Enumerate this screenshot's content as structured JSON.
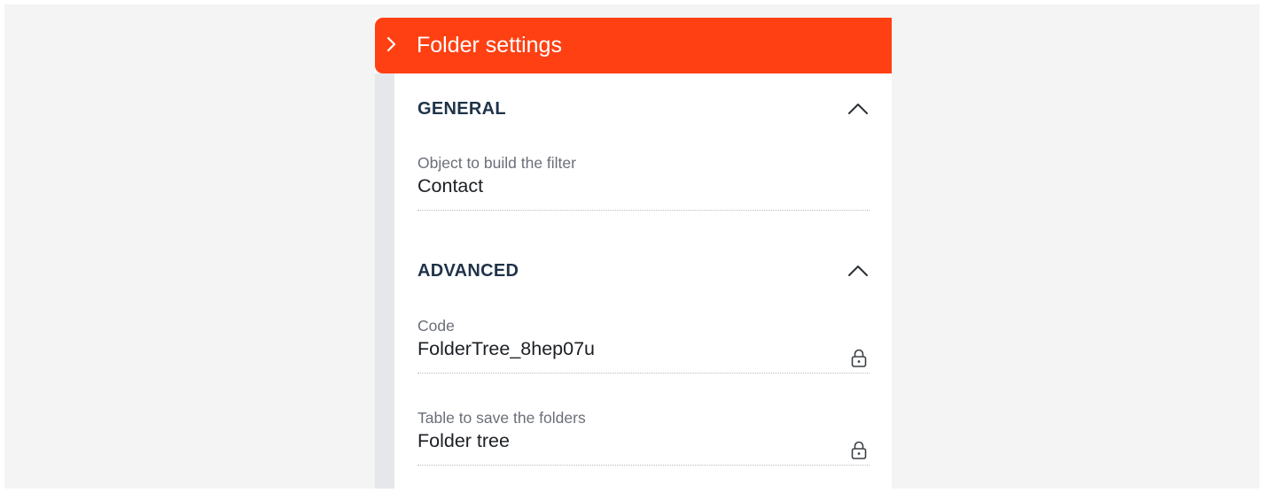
{
  "header": {
    "title": "Folder settings",
    "toggle_icon": "chevron-right-icon",
    "color": "#ff4013"
  },
  "sections": [
    {
      "title": "GENERAL",
      "expanded": true,
      "fields": [
        {
          "label": "Object to build the filter",
          "value": "Contact",
          "locked": false
        }
      ]
    },
    {
      "title": "ADVANCED",
      "expanded": true,
      "fields": [
        {
          "label": "Code",
          "value": "FolderTree_8hep07u",
          "locked": true
        },
        {
          "label": "Table to save the folders",
          "value": "Folder tree",
          "locked": true
        }
      ]
    }
  ],
  "colors": {
    "accent": "#ff4013",
    "section_title": "#1f3349",
    "label": "#6a6f77",
    "value": "#1c1f24",
    "rail": "#e6e7ea",
    "background": "#f4f4f5"
  }
}
